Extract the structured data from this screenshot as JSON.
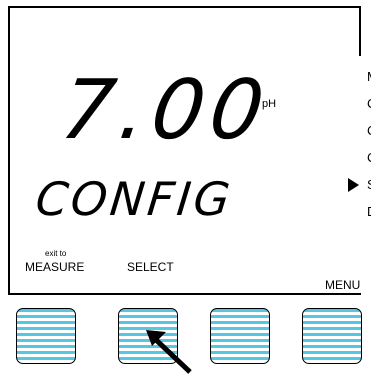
{
  "display": {
    "reading": "7.00",
    "unit": "pH",
    "status_word": "CONFIG",
    "menu_items": [
      "M",
      "C",
      "C",
      "C",
      "S",
      "D"
    ],
    "selected_menu_index": 3
  },
  "softkeys": {
    "key1_sublabel": "exit to",
    "key1_label": "MEASURE",
    "key2_label": "SELECT",
    "key4_label": "MENU"
  },
  "colors": {
    "key_stripe": "#57c6e3",
    "pointer": "#000000"
  },
  "icons": {
    "selection_pointer": "triangle-right-icon",
    "press_indicator": "arrow-up-left-icon"
  }
}
